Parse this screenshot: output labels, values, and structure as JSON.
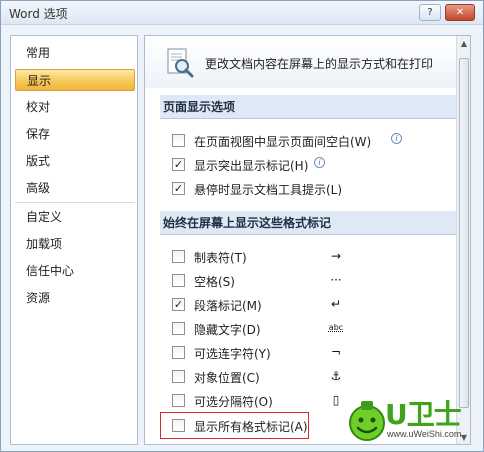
{
  "window": {
    "title": "Word 选项"
  },
  "titlebar": {
    "help_icon": "?",
    "close_icon": "✕"
  },
  "sidebar": {
    "items": [
      {
        "label": "常用"
      },
      {
        "label": "显示",
        "selected": true
      },
      {
        "label": "校对"
      },
      {
        "label": "保存"
      },
      {
        "label": "版式"
      },
      {
        "label": "高级"
      },
      {
        "label": "自定义"
      },
      {
        "label": "加载项"
      },
      {
        "label": "信任中心"
      },
      {
        "label": "资源"
      }
    ]
  },
  "header": {
    "text": "更改文档内容在屏幕上的显示方式和在打印",
    "icon": "magnifier-document-icon"
  },
  "page_display": {
    "title": "页面显示选项",
    "options": [
      {
        "label": "在页面视图中显示页面间空白(W)",
        "checked": false,
        "info": true
      },
      {
        "label": "显示突出显示标记(H)",
        "checked": true,
        "info": true
      },
      {
        "label": "悬停时显示文档工具提示(L)",
        "checked": true,
        "info": false
      }
    ]
  },
  "format_marks": {
    "title": "始终在屏幕上显示这些格式标记",
    "options": [
      {
        "label": "制表符(T)",
        "checked": false,
        "symbol": "→"
      },
      {
        "label": "空格(S)",
        "checked": false,
        "symbol": "···"
      },
      {
        "label": "段落标记(M)",
        "checked": true,
        "symbol": "↵"
      },
      {
        "label": "隐藏文字(D)",
        "checked": false,
        "symbol": "abc"
      },
      {
        "label": "可选连字符(Y)",
        "checked": false,
        "symbol": "¬"
      },
      {
        "label": "对象位置(C)",
        "checked": false,
        "symbol": "⚓"
      },
      {
        "label": "可选分隔符(O)",
        "checked": false,
        "symbol": "▯"
      },
      {
        "label": "显示所有格式标记(A)",
        "checked": false,
        "symbol": ""
      }
    ]
  },
  "check_mark": "✓",
  "watermark": {
    "text": "U卫士",
    "url": "www.uWeiShi.com"
  },
  "colors": {
    "accent": "#f7c958",
    "highlight_box": "#d82a2a",
    "logo_green": "#3fa31d"
  }
}
